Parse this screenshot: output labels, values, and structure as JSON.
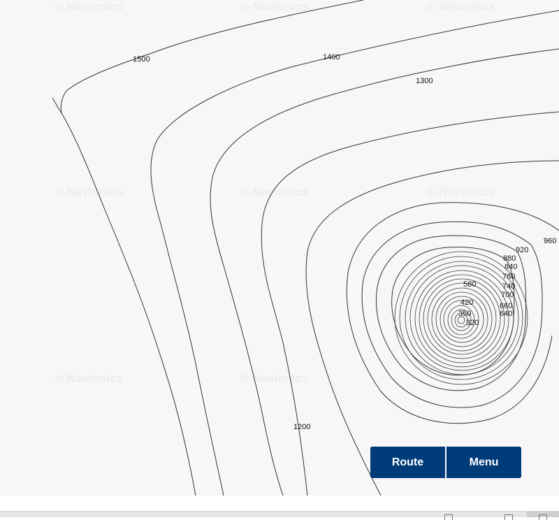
{
  "map": {
    "watermark_text": "© Navionics",
    "contour_labels": [
      "1500",
      "1400",
      "1300",
      "1200",
      "960",
      "920",
      "880",
      "840",
      "780",
      "740",
      "700",
      "660",
      "640",
      "580",
      "420",
      "350",
      "320"
    ]
  },
  "controls": {
    "route_label": "Route",
    "menu_label": "Menu"
  },
  "colors": {
    "map_background": "#f7f7f7",
    "contour_line": "#333333",
    "button_background": "#003b7a",
    "button_text": "#ffffff",
    "watermark": "#ececec"
  },
  "icons": [
    "fullscreen-icon",
    "layers-icon",
    "panel-icon"
  ]
}
